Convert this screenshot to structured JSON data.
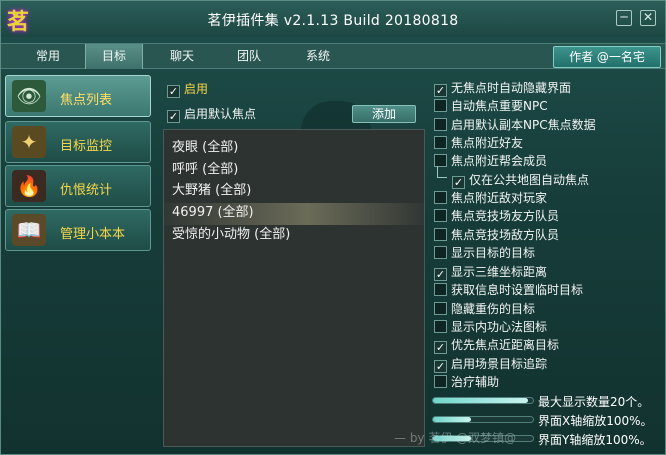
{
  "window": {
    "title": "茗伊插件集 v2.1.13 Build 20180818",
    "logo_glyph": "茗",
    "minimize_glyph": "─",
    "close_glyph": "✕"
  },
  "tabs": [
    {
      "label": "常用",
      "active": false
    },
    {
      "label": "目标",
      "active": true
    },
    {
      "label": "聊天",
      "active": false
    },
    {
      "label": "团队",
      "active": false
    },
    {
      "label": "系统",
      "active": false
    }
  ],
  "author_button": "作者 @一名宅",
  "sidebar": {
    "items": [
      {
        "label": "焦点列表",
        "icon": "eye-book-icon",
        "glyph": "👁",
        "active": true
      },
      {
        "label": "目标监控",
        "icon": "crest-icon",
        "glyph": "✦",
        "active": false
      },
      {
        "label": "仇恨统计",
        "icon": "flame-icon",
        "glyph": "🔥",
        "active": false
      },
      {
        "label": "管理小本本",
        "icon": "book-icon",
        "glyph": "📖",
        "active": false
      }
    ]
  },
  "focus": {
    "enable_label": "启用",
    "enable_checked": true,
    "default_focus_label": "启用默认焦点",
    "default_focus_checked": true,
    "add_button": "添加",
    "list": [
      {
        "text": "夜眼 (全部)",
        "selected": false
      },
      {
        "text": "呼呼 (全部)",
        "selected": false
      },
      {
        "text": "大野猪 (全部)",
        "selected": false
      },
      {
        "text": "46997 (全部)",
        "selected": true
      },
      {
        "text": "受惊的小动物 (全部)",
        "selected": false
      }
    ]
  },
  "options": [
    {
      "label": "无焦点时自动隐藏界面",
      "checked": true
    },
    {
      "label": "自动焦点重要NPC",
      "checked": false
    },
    {
      "label": "启用默认副本NPC焦点数据",
      "checked": false
    },
    {
      "label": "焦点附近好友",
      "checked": false
    },
    {
      "label": "焦点附近帮会成员",
      "checked": false
    },
    {
      "label": "仅在公共地图自动焦点",
      "checked": true,
      "sub": true
    },
    {
      "label": "焦点附近敌对玩家",
      "checked": false
    },
    {
      "label": "焦点竞技场友方队员",
      "checked": false
    },
    {
      "label": "焦点竞技场敌方队员",
      "checked": false
    },
    {
      "label": "显示目标的目标",
      "checked": false
    },
    {
      "label": "显示三维坐标距离",
      "checked": true
    },
    {
      "label": "获取信息时设置临时目标",
      "checked": false
    },
    {
      "label": "隐藏重伤的目标",
      "checked": false
    },
    {
      "label": "显示内功心法图标",
      "checked": false
    },
    {
      "label": "优先焦点近距离目标",
      "checked": true
    },
    {
      "label": "启用场景目标追踪",
      "checked": true
    },
    {
      "label": "治疗辅助",
      "checked": false
    }
  ],
  "sliders": [
    {
      "label": "最大显示数量20个。",
      "fraction": 0.95
    },
    {
      "label": "界面X轴缩放100%。",
      "fraction": 0.38
    },
    {
      "label": "界面Y轴缩放100%。",
      "fraction": 0.38
    }
  ],
  "watermark": "— by 茗伊 @双梦镇@ "
}
